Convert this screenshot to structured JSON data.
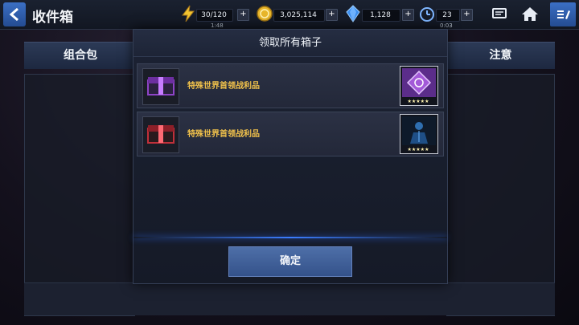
{
  "header": {
    "title": "收件箱",
    "back_icon": "back-arrow-icon"
  },
  "resources": {
    "energy": {
      "value": "30/120",
      "timer": "1:48",
      "icon": "lightning-icon"
    },
    "gold": {
      "value": "3,025,114",
      "icon": "gold-coin-icon"
    },
    "crystal": {
      "value": "1,128",
      "icon": "crystal-icon"
    },
    "stamina": {
      "value": "23",
      "timer": "0:03",
      "icon": "timer-icon"
    },
    "plus_label": "+"
  },
  "toolbar": {
    "chat_icon": "chat-icon",
    "home_icon": "home-icon",
    "menu_icon": "menu-icon"
  },
  "left_panel": {
    "title": "组合包"
  },
  "right_panel": {
    "title": "注意"
  },
  "modal": {
    "title": "领取所有箱子",
    "items": [
      {
        "label": "特殊世界首领战利品",
        "box_color": "#8e44c7",
        "reward_icon": "purple-crystal-icon",
        "stars": "★★★★★"
      },
      {
        "label": "特殊世界首领战利品",
        "box_color": "#c0303a",
        "reward_icon": "character-card-icon",
        "stars": "★★★★★"
      }
    ],
    "confirm_label": "确定"
  },
  "colors": {
    "accent_blue": "#3b7dff",
    "gold_text": "#f0c14b"
  }
}
